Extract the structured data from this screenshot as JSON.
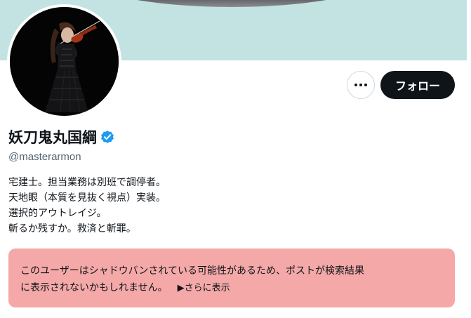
{
  "profile": {
    "display_name": "妖刀鬼丸国綱",
    "handle": "@masterarmon",
    "bio_lines": [
      "宅建士。担当業務は別班で調停者。",
      "天地眼（本質を見抜く視点）実装。",
      "選択的アウトレイジ。",
      "斬るか残すか。救済と斬罪。"
    ]
  },
  "actions": {
    "follow_label": "フォロー"
  },
  "notice": {
    "line1": "このユーザーはシャドウバンされている可能性があるため、ポストが検索結果",
    "line2": "に表示されないかもしれません。",
    "show_more": "▶さらに表示"
  },
  "colors": {
    "banner": "#c3e3e3",
    "follow_button": "#0f1419",
    "verified": "#1d9bf0",
    "notice_bg": "#f4a9a8",
    "handle_text": "#536471"
  },
  "icons": {
    "more": "more-dots-icon",
    "verified": "verified-badge-icon"
  }
}
